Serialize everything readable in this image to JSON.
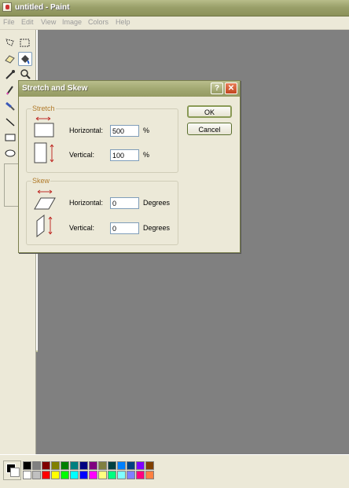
{
  "window": {
    "title": "untitled - Paint"
  },
  "menu": [
    "File",
    "Edit",
    "View",
    "Image",
    "Colors",
    "Help"
  ],
  "tools": [
    {
      "name": "free-form-select-icon",
      "selected": false
    },
    {
      "name": "rect-select-icon",
      "selected": false
    },
    {
      "name": "eraser-icon",
      "selected": false
    },
    {
      "name": "fill-icon",
      "selected": true
    },
    {
      "name": "color-picker-icon",
      "selected": false
    },
    {
      "name": "magnifier-icon",
      "selected": false
    },
    {
      "name": "pencil-icon",
      "selected": false
    },
    {
      "name": "brush-icon",
      "selected": false
    },
    {
      "name": "line-icon",
      "selected": false
    },
    {
      "name": "rectangle-icon",
      "selected": false
    },
    {
      "name": "ellipse-icon",
      "selected": false
    }
  ],
  "palette": {
    "primary": "#000000",
    "secondary": "#ffffff",
    "colors_row1": [
      "#000000",
      "#808080",
      "#800000",
      "#808000",
      "#008000",
      "#008080",
      "#000080",
      "#800080",
      "#808040",
      "#004040",
      "#0080ff",
      "#004080",
      "#8000ff",
      "#804000"
    ],
    "colors_row2": [
      "#ffffff",
      "#c0c0c0",
      "#ff0000",
      "#ffff00",
      "#00ff00",
      "#00ffff",
      "#0000ff",
      "#ff00ff",
      "#ffff80",
      "#00ff80",
      "#80ffff",
      "#8080ff",
      "#ff0080",
      "#ff8040"
    ]
  },
  "dialog": {
    "title": "Stretch and Skew",
    "help_label": "?",
    "close_label": "✕",
    "stretch": {
      "label": "Stretch",
      "horizontal": {
        "label": "Horizontal:",
        "value": "500",
        "unit": "%"
      },
      "vertical": {
        "label": "Vertical:",
        "value": "100",
        "unit": "%"
      }
    },
    "skew": {
      "label": "Skew",
      "horizontal": {
        "label": "Horizontal:",
        "value": "0",
        "unit": "Degrees"
      },
      "vertical": {
        "label": "Vertical:",
        "value": "0",
        "unit": "Degrees"
      }
    },
    "ok_label": "OK",
    "cancel_label": "Cancel"
  }
}
